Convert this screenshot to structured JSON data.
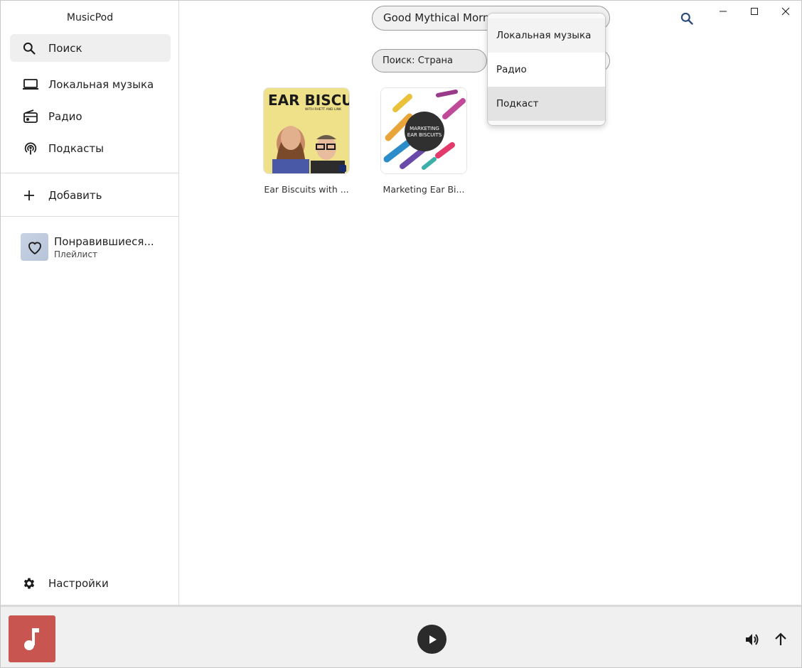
{
  "app": {
    "title": "MusicPod"
  },
  "sidebar": {
    "items": [
      {
        "label": "Поиск",
        "icon": "search-icon",
        "active": true
      },
      {
        "label": "Локальная музыка",
        "icon": "laptop-icon"
      },
      {
        "label": "Радио",
        "icon": "radio-icon"
      },
      {
        "label": "Подкасты",
        "icon": "podcast-icon"
      }
    ],
    "add_label": "Добавить",
    "playlist": {
      "name": "Понравившиеся...",
      "type": "Плейлист"
    },
    "settings_label": "Настройки"
  },
  "search": {
    "value": "Good Mythical Morning",
    "country_label": "Поиск: Страна"
  },
  "dropdown": {
    "options": [
      "Локальная музыка",
      "Радио",
      "Подкаст"
    ],
    "selected": "Подкаст"
  },
  "results": [
    {
      "title": "Ear Biscuits with ...",
      "art_text_top": "EAR BISCUITS",
      "art_text_sub": "WITH RHETT AND LINK"
    },
    {
      "title": "Marketing Ear Bi...",
      "art_text_top": "MARKETING",
      "art_text_sub": "EAR BISCUITS"
    }
  ],
  "colors": {
    "accent": "#2b4a7a",
    "cover": "#c8554f"
  }
}
